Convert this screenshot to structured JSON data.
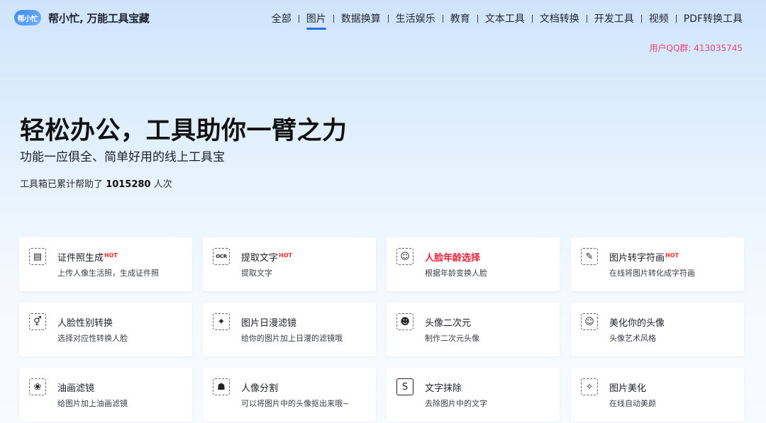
{
  "header": {
    "logo_badge": "帮小忙",
    "logo_text": "帮小忙, 万能工具宝藏",
    "nav": [
      {
        "label": "全部",
        "active": false
      },
      {
        "label": "图片",
        "active": true
      },
      {
        "label": "数据换算",
        "active": false
      },
      {
        "label": "生活娱乐",
        "active": false
      },
      {
        "label": "教育",
        "active": false
      },
      {
        "label": "文本工具",
        "active": false
      },
      {
        "label": "文档转换",
        "active": false
      },
      {
        "label": "开发工具",
        "active": false
      },
      {
        "label": "视频",
        "active": false
      },
      {
        "label": "PDF转换工具",
        "active": false
      }
    ],
    "qq_group": "用户QQ群: 413035745"
  },
  "hero": {
    "title": "轻松办公，工具助你一臂之力",
    "subtitle": "功能一应俱全、简单好用的线上工具宝",
    "count_prefix": "工具箱已累计帮助了",
    "count_value": "1015280",
    "count_suffix": "人次"
  },
  "colors": {
    "accent": "#1f6fe8",
    "hot": "#ff2a2a",
    "qq": "#f0437a",
    "highlight_title": "#e8223a"
  },
  "tools": [
    {
      "title": "证件照生成",
      "hot": "HOT",
      "desc": "上传人像生活照，生成证件照",
      "icon": "id-card-icon",
      "glyph": "▤",
      "highlight": false
    },
    {
      "title": "提取文字",
      "hot": "HOT",
      "desc": "提取文字",
      "icon": "ocr-icon",
      "glyph": "OCR",
      "highlight": false
    },
    {
      "title": "人脸年龄选择",
      "hot": "",
      "desc": "根据年龄变换人脸",
      "icon": "face-age-icon",
      "glyph": "☺",
      "highlight": true
    },
    {
      "title": "图片转字符画",
      "hot": "HOT",
      "desc": "在线将图片转化成字符画",
      "icon": "char-art-icon",
      "glyph": "✎",
      "highlight": false
    },
    {
      "title": "人脸性别转换",
      "hot": "",
      "desc": "选择对应性转换人脸",
      "icon": "gender-icon",
      "glyph": "⚥",
      "highlight": false
    },
    {
      "title": "图片日漫滤镜",
      "hot": "",
      "desc": "给你的图片加上日漫的滤镜哦",
      "icon": "anime-filter-icon",
      "glyph": "✦",
      "highlight": false
    },
    {
      "title": "头像二次元",
      "hot": "",
      "desc": "制作二次元头像",
      "icon": "anime-avatar-icon",
      "glyph": "☻",
      "highlight": false
    },
    {
      "title": "美化你的头像",
      "hot": "",
      "desc": "头像艺术风格",
      "icon": "beauty-avatar-icon",
      "glyph": "☺",
      "highlight": false
    },
    {
      "title": "油画滤镜",
      "hot": "",
      "desc": "给图片加上油画滤镜",
      "icon": "oil-paint-icon",
      "glyph": "❀",
      "highlight": false
    },
    {
      "title": "人像分割",
      "hot": "",
      "desc": "可以将图片中的头像抠出来哦~",
      "icon": "portrait-segment-icon",
      "glyph": "☗",
      "highlight": false
    },
    {
      "title": "文字抹除",
      "hot": "",
      "desc": "去除图片中的文字",
      "icon": "text-erase-icon",
      "glyph": "S",
      "highlight": false
    },
    {
      "title": "图片美化",
      "hot": "",
      "desc": "在线自动美颜",
      "icon": "photo-beautify-icon",
      "glyph": "✧",
      "highlight": false
    }
  ]
}
